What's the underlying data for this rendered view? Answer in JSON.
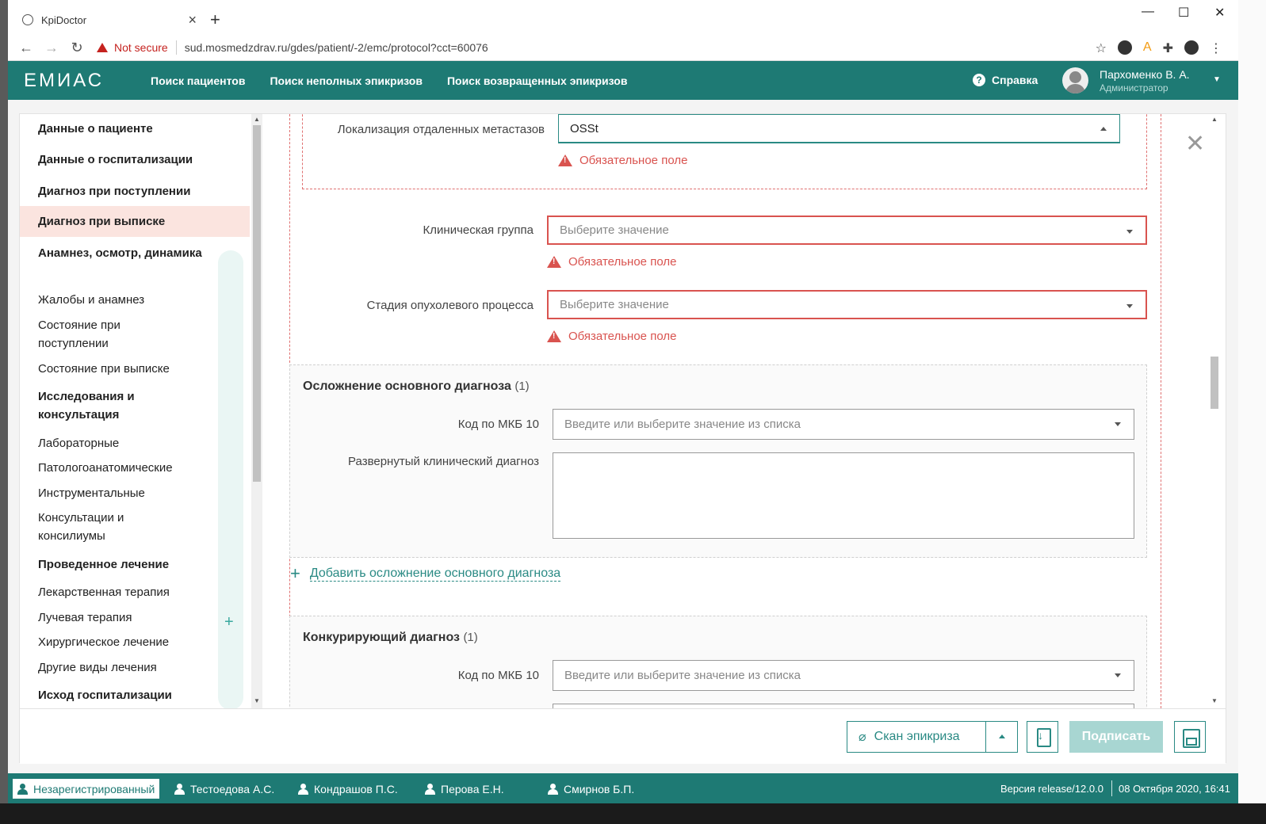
{
  "browser": {
    "tab_title": "KpiDoctor",
    "not_secure": "Not secure",
    "url": "sud.mosmedzdrav.ru/gdes/patient/-2/emc/protocol?cct=60076"
  },
  "header": {
    "logo": "ЕМИАС",
    "nav": [
      "Поиск пациентов",
      "Поиск неполных эпикризов",
      "Поиск возвращенных эпикризов"
    ],
    "help": "Справка",
    "user_name": "Пархоменко В. А.",
    "user_role": "Администратор"
  },
  "sidebar": {
    "items": [
      {
        "label": "Данные о пациенте",
        "bold": true
      },
      {
        "label": "Данные о госпитализации",
        "bold": true
      },
      {
        "label": "Диагноз при поступлении",
        "bold": true
      },
      {
        "label": "Диагноз при выписке",
        "bold": true,
        "active": true
      },
      {
        "label": "Анамнез, осмотр, динамика",
        "bold": true
      },
      {
        "label": "Жалобы и анамнез"
      },
      {
        "label": "Состояние при поступлении"
      },
      {
        "label": "Состояние при выписке"
      },
      {
        "label": "Исследования и консультация",
        "bold": true
      },
      {
        "label": "Лабораторные"
      },
      {
        "label": "Патологоанатомические"
      },
      {
        "label": "Инструментальные"
      },
      {
        "label": "Консультации и консилиумы"
      },
      {
        "label": "Проведенное лечение",
        "bold": true
      },
      {
        "label": "Лекарственная терапия"
      },
      {
        "label": "Лучевая терапия"
      },
      {
        "label": "Хирургическое лечение"
      },
      {
        "label": "Другие виды лечения"
      },
      {
        "label": "Исход госпитализации",
        "bold": true
      }
    ]
  },
  "form": {
    "metastases": {
      "label": "Локализация отдаленных метастазов",
      "value": "OSSt"
    },
    "clinical_group": {
      "label": "Клиническая группа",
      "placeholder": "Выберите значение"
    },
    "tumor_stage": {
      "label": "Стадия опухолевого процесса",
      "placeholder": "Выберите значение"
    },
    "required_msg": "Обязательное поле",
    "complication": {
      "title": "Осложнение основного диагноза",
      "count": "(1)",
      "mkb_label": "Код по МКБ 10",
      "mkb_placeholder": "Введите или выберите значение из списка",
      "diag_label": "Развернутый клинический диагноз",
      "add_link": "Добавить осложнение основного диагноза"
    },
    "competing": {
      "title": "Конкурирующий диагноз",
      "count": "(1)",
      "mkb_label": "Код по МКБ 10",
      "mkb_placeholder": "Введите или выберите значение из списка"
    }
  },
  "footer": {
    "scan": "Скан эпикриза",
    "sign": "Подписать"
  },
  "statusbar": {
    "users": [
      "Незарегистрированный",
      "Тестоедова А.С.",
      "Кондрашов П.С.",
      "Перова Е.Н.",
      "Смирнов Б.П."
    ],
    "version": "Версия release/12.0.0",
    "date": "08 Октября 2020, 16:41"
  }
}
